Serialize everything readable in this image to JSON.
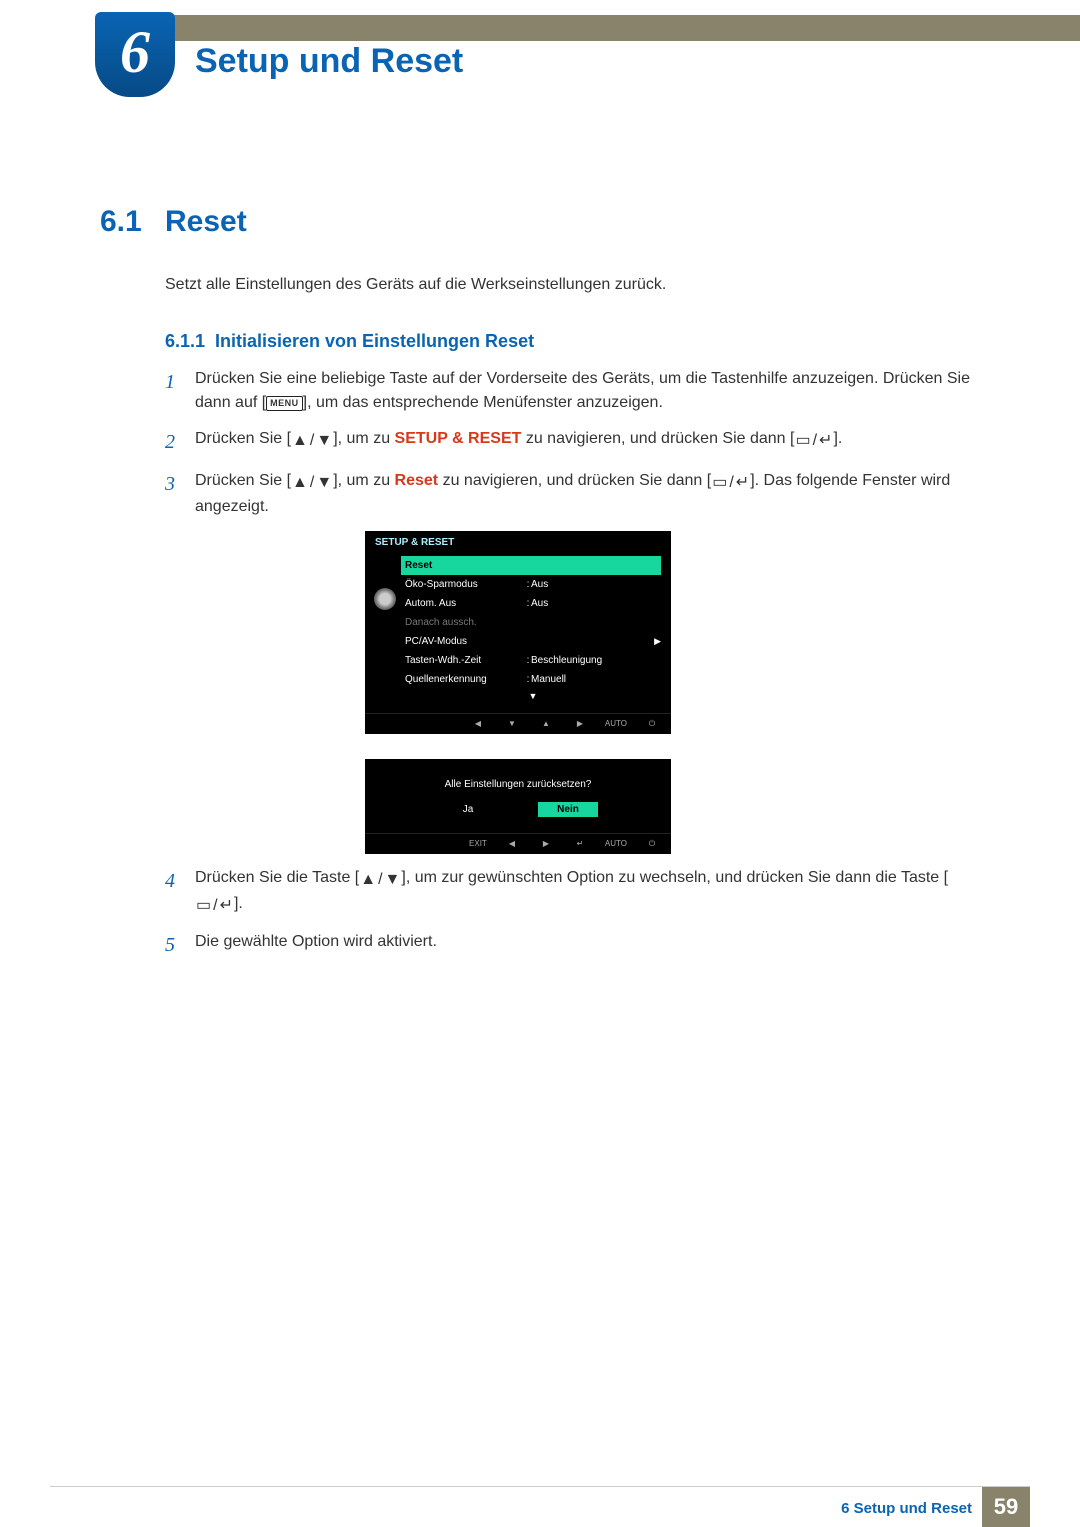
{
  "chapter": {
    "number": "6",
    "title": "Setup und Reset"
  },
  "section": {
    "number": "6.1",
    "title": "Reset",
    "intro": "Setzt alle Einstellungen des Geräts auf die Werkseinstellungen zurück."
  },
  "subsection": {
    "number": "6.1.1",
    "title": "Initialisieren von Einstellungen Reset"
  },
  "steps": {
    "s1a": "Drücken Sie eine beliebige Taste auf der Vorderseite des Geräts, um die Tastenhilfe anzuzeigen. Drücken Sie dann auf [",
    "s1b": "], um das entsprechende Menüfenster anzuzeigen.",
    "s2a": "Drücken Sie [",
    "s2b": "], um zu ",
    "s2hi": "SETUP & RESET",
    "s2c": " zu navigieren, und drücken Sie dann [",
    "s2d": "].",
    "s3a": "Drücken Sie [",
    "s3b": "], um zu ",
    "s3hi": "Reset",
    "s3c": " zu navigieren, und drücken Sie dann [",
    "s3d": "]. Das folgende Fenster wird angezeigt.",
    "s4a": "Drücken Sie die Taste [",
    "s4b": "], um zur gewünschten Option zu wechseln, und drücken Sie dann die Taste [",
    "s4c": "].",
    "s5": "Die gewählte Option wird aktiviert."
  },
  "step_nums": {
    "n1": "1",
    "n2": "2",
    "n3": "3",
    "n4": "4",
    "n5": "5"
  },
  "keys": {
    "menu": "MENU",
    "auto": "AUTO",
    "exit": "EXIT"
  },
  "osd1": {
    "title": "SETUP & RESET",
    "rows": [
      {
        "label": "Reset",
        "value": "",
        "sel": true
      },
      {
        "label": "Öko-Sparmodus",
        "value": "Aus"
      },
      {
        "label": "Autom. Aus",
        "value": "Aus"
      },
      {
        "label": "Danach aussch.",
        "value": "",
        "dis": true
      },
      {
        "label": "PC/AV-Modus",
        "value": "",
        "arrow": true
      },
      {
        "label": "Tasten-Wdh.-Zeit",
        "value": "Beschleunigung"
      },
      {
        "label": "Quellenerkennung",
        "value": "Manuell"
      }
    ]
  },
  "osd2": {
    "message": "Alle Einstellungen zurücksetzen?",
    "yes": "Ja",
    "no": "Nein"
  },
  "footer": {
    "text": "6 Setup und Reset",
    "page": "59"
  }
}
